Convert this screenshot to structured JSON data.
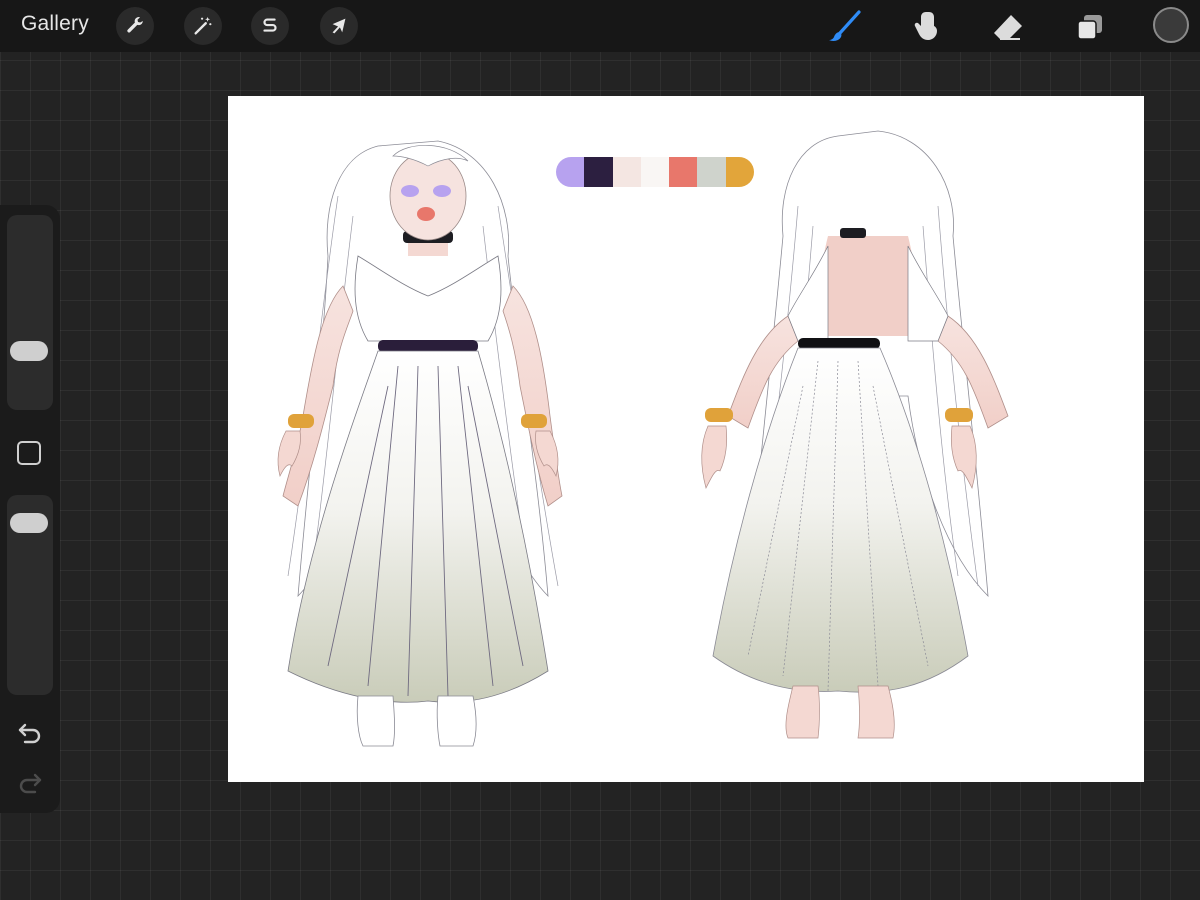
{
  "toolbar": {
    "gallery_label": "Gallery",
    "left_tools": [
      {
        "name": "actions",
        "icon": "wrench-icon"
      },
      {
        "name": "adjustments",
        "icon": "magic-wand-icon"
      },
      {
        "name": "selection",
        "icon": "selection-s-icon"
      },
      {
        "name": "transform",
        "icon": "arrow-cursor-icon"
      }
    ],
    "right_tools": [
      {
        "name": "brush",
        "icon": "brush-icon",
        "active": true
      },
      {
        "name": "smudge",
        "icon": "smudge-finger-icon"
      },
      {
        "name": "eraser",
        "icon": "eraser-icon"
      },
      {
        "name": "layers",
        "icon": "layers-icon"
      }
    ],
    "current_color": "#3a3a3a",
    "active_tool_color": "#2f8cf7"
  },
  "sidebar": {
    "brush_size_level": 0.27,
    "opacity_level": 0.92,
    "undo_icon": "undo-icon",
    "redo_icon": "redo-icon",
    "modify_icon": "square-modify-icon"
  },
  "artwork": {
    "palette": [
      "#b7a2ef",
      "#2c1f40",
      "#f4e6e2",
      "#f9f6f4",
      "#e8776b",
      "#cfd3cc",
      "#e2a53a"
    ],
    "accent_colors": {
      "choker_belt": "#2a1e3a",
      "bracelet": "#e0a23a",
      "skin": "#f4d8d2",
      "dress_shadow": "#c9ccb9"
    }
  }
}
